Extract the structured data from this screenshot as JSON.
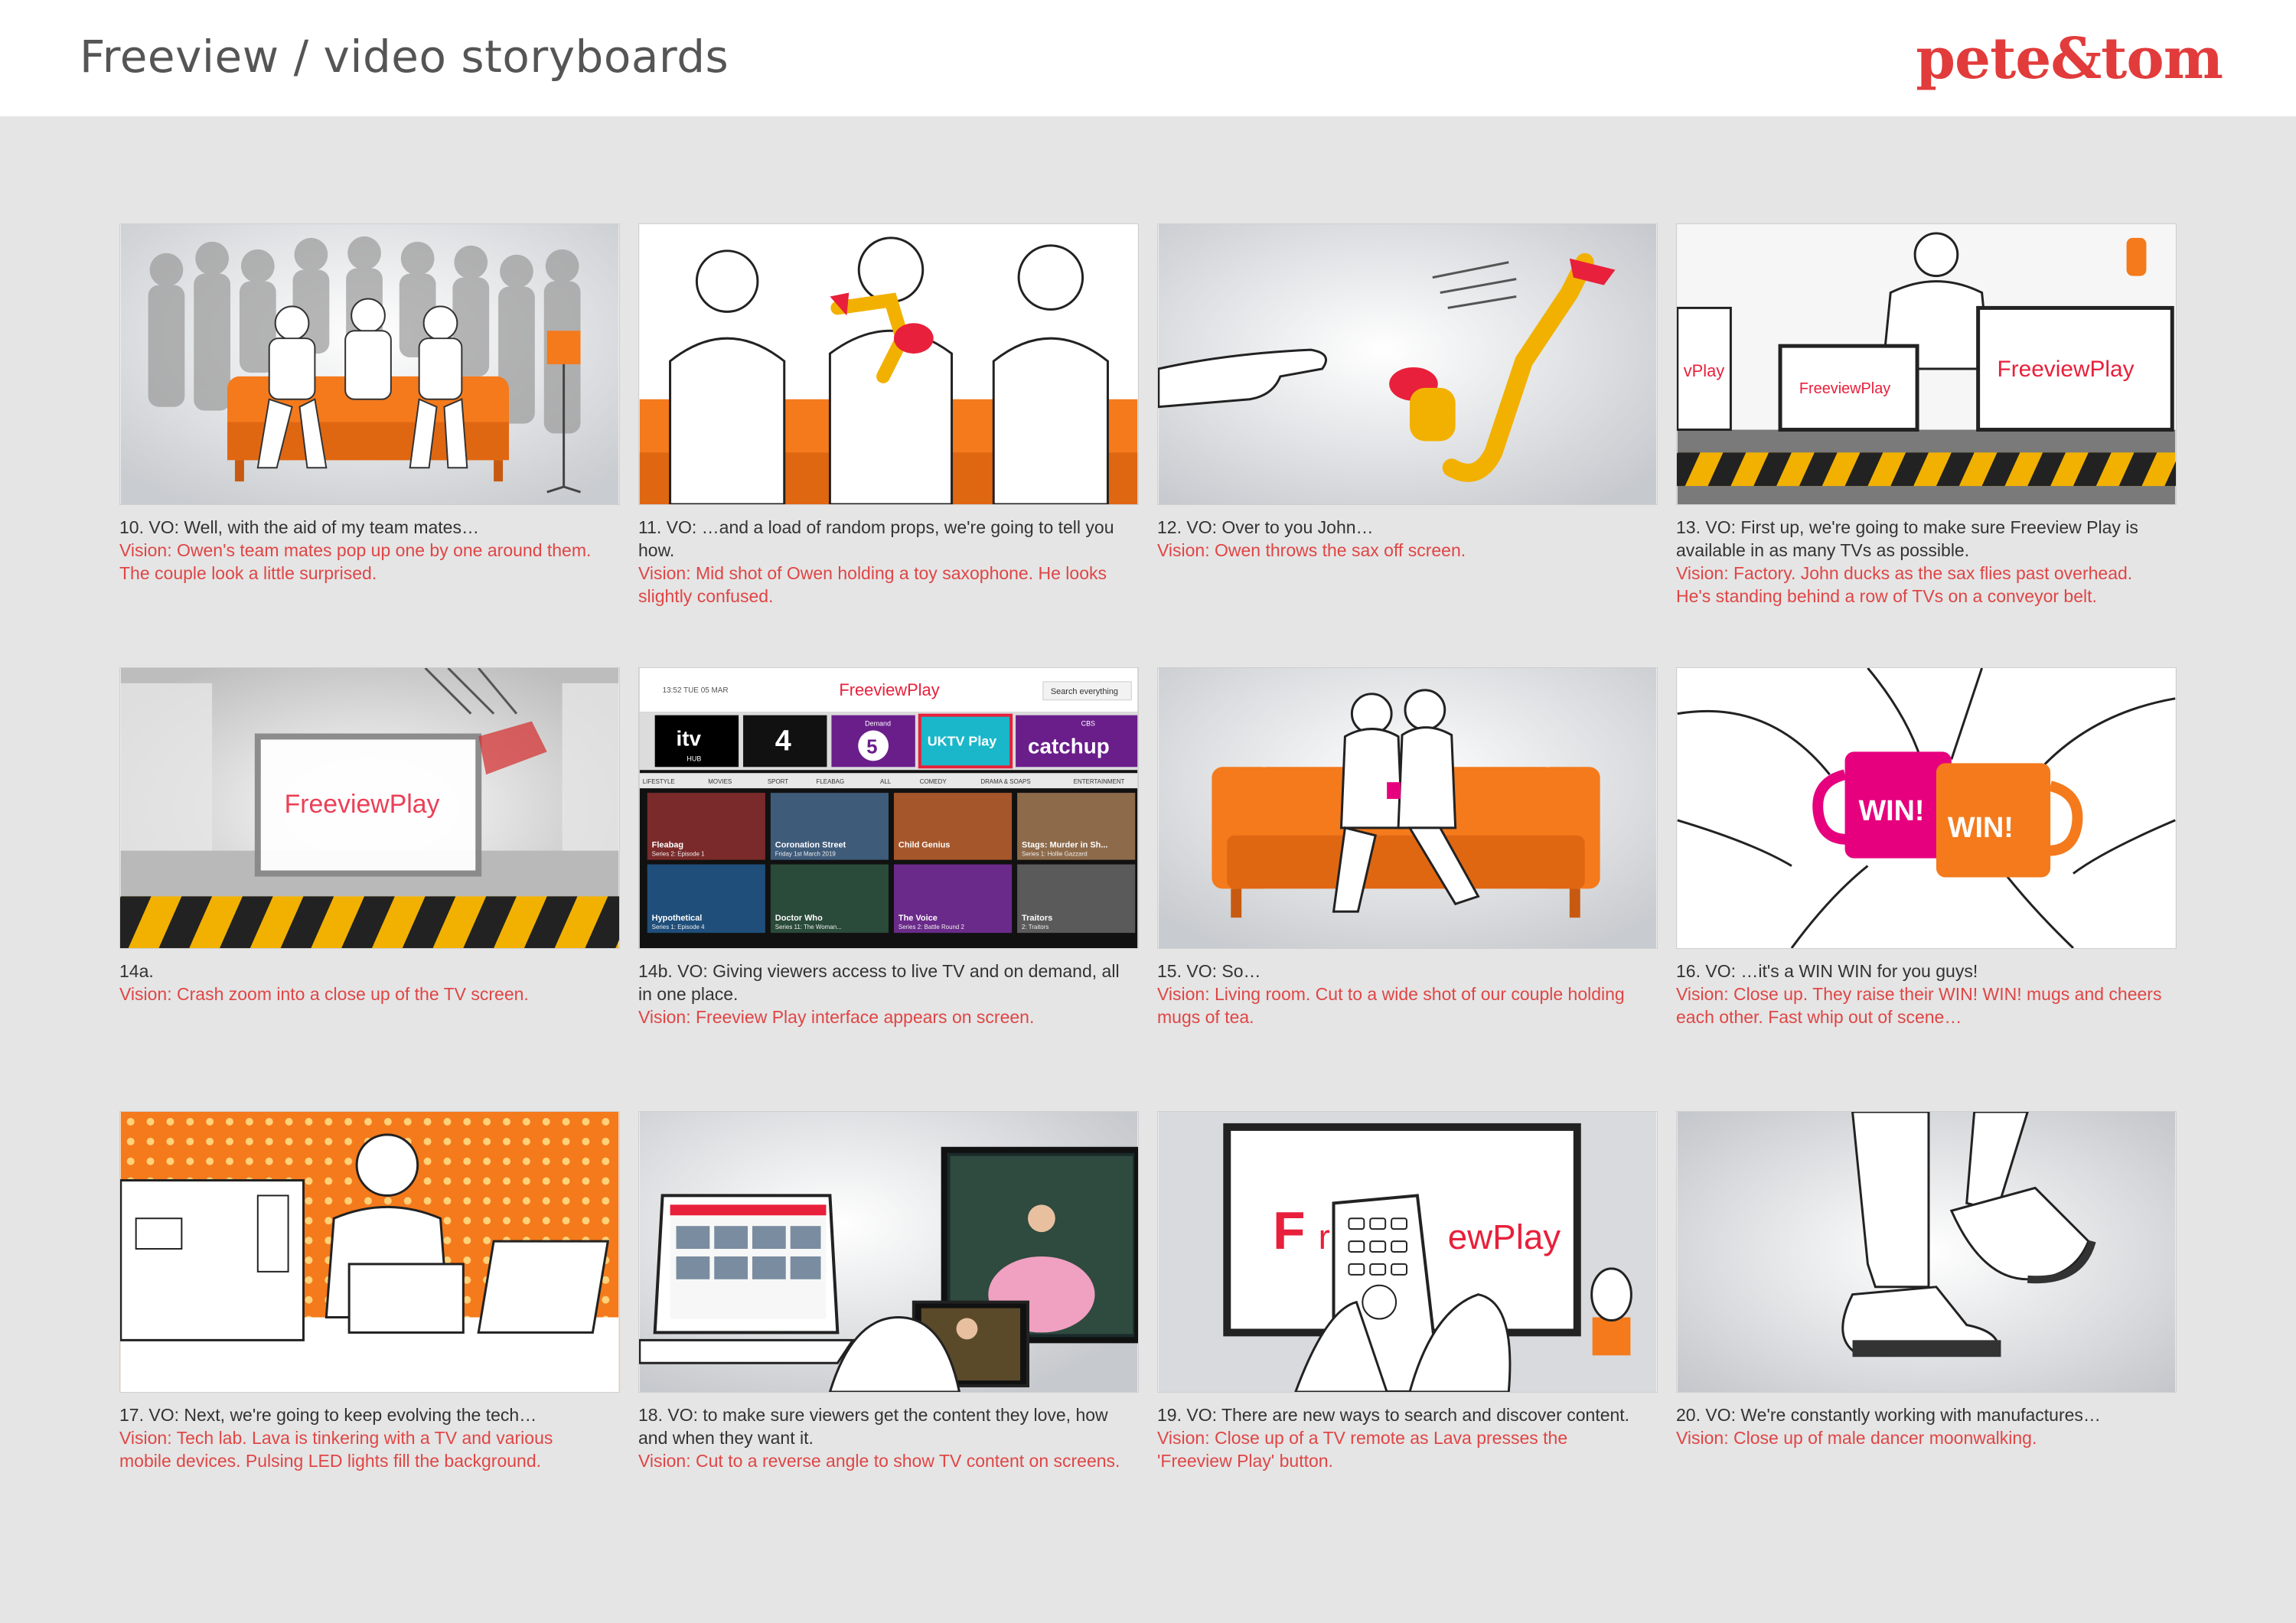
{
  "header": {
    "title": "Freeview / video storyboards",
    "logo": "pete&tom"
  },
  "colors": {
    "accent": "#e23b3b",
    "orange": "#f47a1c",
    "magenta": "#e6007e",
    "caption_red": "#e04545"
  },
  "panels": [
    {
      "vo": "10. VO: Well, with the aid of my team mates…",
      "vision": "Vision: Owen's team mates pop up one by one around them. The couple look a little surprised."
    },
    {
      "vo": "11. VO: …and a load of random props, we're going to tell you how.",
      "vision": "Vision: Mid shot of Owen holding a toy saxophone. He looks slightly confused."
    },
    {
      "vo": "12. VO: Over to you John…",
      "vision": "Vision: Owen throws the sax off screen."
    },
    {
      "vo": "13. VO: First up, we're going to make sure Freeview Play is available in as many TVs as possible.",
      "vision": "Vision: Factory. John ducks as the sax flies past overhead. He's standing behind a row of TVs on a conveyor belt."
    },
    {
      "vo": "14a.",
      "vision": "Vision: Crash zoom into a close up of the TV screen."
    },
    {
      "vo": "14b. VO: Giving viewers access to live TV and on demand, all in one place.",
      "vision": "Vision: Freeview Play interface appears on screen."
    },
    {
      "vo": "15. VO: So…",
      "vision": "Vision: Living room. Cut to a wide shot of our couple holding mugs of tea."
    },
    {
      "vo": "16. VO: …it's a WIN WIN for you guys!",
      "vision": "Vision: Close up. They raise their WIN! WIN! mugs and cheers each other. Fast whip out of scene…"
    },
    {
      "vo": "17. VO: Next, we're going to keep evolving the tech…",
      "vision": "Vision: Tech lab. Lava is tinkering with a TV and various mobile devices. Pulsing LED lights fill the background."
    },
    {
      "vo": "18. VO: to make sure viewers get the content they love, how and when they want it.",
      "vision": "Vision: Cut to a reverse angle to show TV content on screens."
    },
    {
      "vo": "19. VO: There are new ways to search and discover content.",
      "vision": "Vision: Close up of a TV remote as Lava presses the 'Freeview Play' button."
    },
    {
      "vo": "20. VO: We're constantly working with manufactures…",
      "vision": "Vision: Close up of male dancer moonwalking."
    }
  ],
  "art": {
    "brand": "FreeviewPlay",
    "brand_cropped": "vPlay",
    "ui_clock": "13:52 TUE 05 MAR",
    "ui_search": "Search everything",
    "channels": [
      "itv",
      "4",
      "5",
      "UKTV Play",
      "catchup"
    ],
    "channel_sub": [
      "HUB",
      "",
      "Demand",
      "",
      "CBS"
    ],
    "tabs": [
      "LIFESTYLE",
      "MOVIES",
      "SPORT",
      "FLEABAG",
      "ALL",
      "COMEDY",
      "DRAMA & SOAPS",
      "ENTERTAINMENT"
    ],
    "tiles": [
      "Fleabag",
      "Coronation Street",
      "Child Genius",
      "Stags: Murder in Sh...",
      "Hypothetical",
      "Doctor Who",
      "The Voice",
      "Traitors"
    ],
    "tile_subs": [
      "Series 2: Episode 1",
      "Friday 1st March 2019",
      "",
      "Series 1: Hollie Gazzard",
      "Series 1: Episode 4",
      "Series 11: The Woman...",
      "Series 2: Battle Round 2",
      "2: Traitors"
    ],
    "mug": "WIN!",
    "remote_brand_a": "F",
    "remote_brand_b": "r",
    "remote_brand_c": "ewPlay"
  }
}
